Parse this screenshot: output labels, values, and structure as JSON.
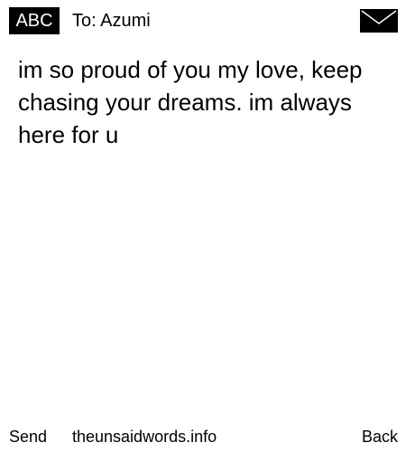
{
  "header": {
    "mode_badge": "ABC",
    "recipient": "To: Azumi",
    "icon": "envelope-icon"
  },
  "message": {
    "body": "im so proud of you my love, keep chasing your dreams. im always here for u"
  },
  "footer": {
    "send_label": "Send",
    "site": "theunsaidwords.info",
    "back_label": "Back"
  },
  "colors": {
    "background": "#ffffff",
    "text": "#000000",
    "badge_background": "#000000",
    "badge_text": "#ffffff"
  }
}
